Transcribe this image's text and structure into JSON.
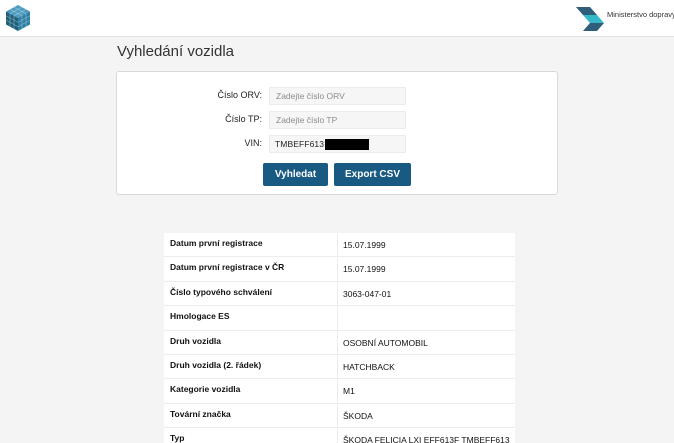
{
  "header": {
    "ministry_name": "Ministerstvo dopravy",
    "colors": {
      "cube": "#1f5f7a",
      "ministry_logo": "#2f5d7a",
      "ministry_accent": "#34b7c9"
    }
  },
  "page": {
    "title": "Vyhledání vozidla"
  },
  "search": {
    "orv_label": "Číslo ORV:",
    "orv_placeholder": "Zadejte číslo ORV",
    "orv_value": "",
    "tp_label": "Číslo TP:",
    "tp_placeholder": "Zadejte číslo TP",
    "tp_value": "",
    "vin_label": "VIN:",
    "vin_value": "TMBEFF613",
    "search_button": "Vyhledat",
    "export_button": "Export CSV",
    "button_color": "#195a82"
  },
  "results": [
    {
      "label": "Datum první registrace",
      "value": "15.07.1999"
    },
    {
      "label": "Datum první registrace v ČR",
      "value": "15.07.1999"
    },
    {
      "label": "Číslo typového schválení",
      "value": "3063-047-01"
    },
    {
      "label": "Hmologace ES",
      "value": ""
    },
    {
      "label": "Druh vozidla",
      "value": "OSOBNÍ AUTOMOBIL"
    },
    {
      "label": "Druh vozidla (2. řádek)",
      "value": "HATCHBACK"
    },
    {
      "label": "Kategorie vozidla",
      "value": "M1"
    },
    {
      "label": "Tovární značka",
      "value": "ŠKODA"
    },
    {
      "label": "Typ",
      "value": "ŠKODA FELICIA LXI EFF613F TMBEFF613"
    }
  ]
}
